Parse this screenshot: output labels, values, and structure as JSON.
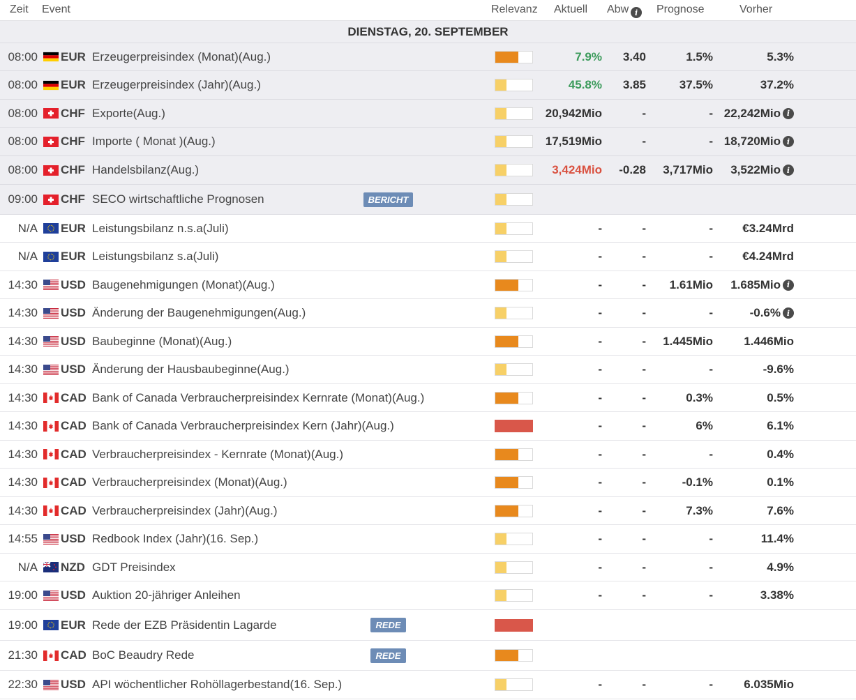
{
  "header": {
    "zeit": "Zeit",
    "event": "Event",
    "relevanz": "Relevanz",
    "aktuell": "Aktuell",
    "abw": "Abw",
    "prognose": "Prognose",
    "vorher": "Vorher"
  },
  "day_label": "DIENSTAG, 20. SEPTEMBER",
  "colors": {
    "high": "#e8891d",
    "high_light": "#f7d067",
    "max": "#d9574a",
    "positive": "#3a9a5a",
    "negative": "#d9503f",
    "badge": "#6d8cb6"
  },
  "rows": [
    {
      "time": "08:00",
      "flag": "DE",
      "currency": "EUR",
      "event": "Erzeugerpreisindex (Monat)(Aug.)",
      "relevance": "medium",
      "actual": "7.9%",
      "actual_state": "pos",
      "abw": "3.40",
      "forecast": "1.5%",
      "previous": "5.3%",
      "info": false,
      "hl": true,
      "h": 40
    },
    {
      "time": "08:00",
      "flag": "DE",
      "currency": "EUR",
      "event": "Erzeugerpreisindex (Jahr)(Aug.)",
      "relevance": "low",
      "actual": "45.8%",
      "actual_state": "pos",
      "abw": "3.85",
      "forecast": "37.5%",
      "previous": "37.2%",
      "info": false,
      "hl": true,
      "h": 41
    },
    {
      "time": "08:00",
      "flag": "CH",
      "currency": "CHF",
      "event": "Exporte(Aug.)",
      "relevance": "low",
      "actual": "20,942Mio",
      "actual_state": "neutral",
      "abw": "-",
      "forecast": "-",
      "previous": "22,242Mio",
      "info": true,
      "hl": true,
      "h": 40
    },
    {
      "time": "08:00",
      "flag": "CH",
      "currency": "CHF",
      "event": "Importe ( Monat )(Aug.)",
      "relevance": "low",
      "actual": "17,519Mio",
      "actual_state": "neutral",
      "abw": "-",
      "forecast": "-",
      "previous": "18,720Mio",
      "info": true,
      "hl": true,
      "h": 41
    },
    {
      "time": "08:00",
      "flag": "CH",
      "currency": "CHF",
      "event": "Handelsbilanz(Aug.)",
      "relevance": "low",
      "actual": "3,424Mio",
      "actual_state": "neg",
      "abw": "-0.28",
      "forecast": "3,717Mio",
      "previous": "3,522Mio",
      "info": true,
      "hl": true,
      "h": 41
    },
    {
      "time": "09:00",
      "flag": "CH",
      "currency": "CHF",
      "event": "SECO wirtschaftliche Prognosen",
      "relevance": "low",
      "badge": "BERICHT",
      "hl": true,
      "h": 43
    },
    {
      "time": "N/A",
      "flag": "EU",
      "currency": "EUR",
      "event": "Leistungsbilanz n.s.a(Juli)",
      "relevance": "low",
      "actual": "-",
      "abw": "-",
      "forecast": "-",
      "previous": "€3.24Mrd",
      "info": false,
      "h": 40
    },
    {
      "time": "N/A",
      "flag": "EU",
      "currency": "EUR",
      "event": "Leistungsbilanz s.a(Juli)",
      "relevance": "low",
      "actual": "-",
      "abw": "-",
      "forecast": "-",
      "previous": "€4.24Mrd",
      "info": false,
      "h": 41
    },
    {
      "time": "14:30",
      "flag": "US",
      "currency": "USD",
      "event": "Baugenehmigungen (Monat)(Aug.)",
      "relevance": "medium",
      "actual": "-",
      "abw": "-",
      "forecast": "1.61Mio",
      "previous": "1.685Mio",
      "info": true,
      "h": 40
    },
    {
      "time": "14:30",
      "flag": "US",
      "currency": "USD",
      "event": "Änderung der Baugenehmigungen(Aug.)",
      "relevance": "low",
      "actual": "-",
      "abw": "-",
      "forecast": "-",
      "previous": "-0.6%",
      "info": true,
      "h": 41
    },
    {
      "time": "14:30",
      "flag": "US",
      "currency": "USD",
      "event": "Baubeginne (Monat)(Aug.)",
      "relevance": "medium",
      "actual": "-",
      "abw": "-",
      "forecast": "1.445Mio",
      "previous": "1.446Mio",
      "info": false,
      "h": 40
    },
    {
      "time": "14:30",
      "flag": "US",
      "currency": "USD",
      "event": "Änderung der Hausbaubeginne(Aug.)",
      "relevance": "low",
      "actual": "-",
      "abw": "-",
      "forecast": "-",
      "previous": "-9.6%",
      "info": false,
      "h": 41
    },
    {
      "time": "14:30",
      "flag": "CA",
      "currency": "CAD",
      "event": "Bank of Canada Verbraucherpreisindex Kernrate (Monat)(Aug.)",
      "relevance": "medium",
      "actual": "-",
      "abw": "-",
      "forecast": "0.3%",
      "previous": "0.5%",
      "info": false,
      "h": 40
    },
    {
      "time": "14:30",
      "flag": "CA",
      "currency": "CAD",
      "event": "Bank of Canada Verbraucherpreisindex Kern (Jahr)(Aug.)",
      "relevance": "high",
      "actual": "-",
      "abw": "-",
      "forecast": "6%",
      "previous": "6.1%",
      "info": false,
      "h": 41
    },
    {
      "time": "14:30",
      "flag": "CA",
      "currency": "CAD",
      "event": "Verbraucherpreisindex - Kernrate (Monat)(Aug.)",
      "relevance": "medium",
      "actual": "-",
      "abw": "-",
      "forecast": "-",
      "previous": "0.4%",
      "info": false,
      "h": 40
    },
    {
      "time": "14:30",
      "flag": "CA",
      "currency": "CAD",
      "event": "Verbraucherpreisindex (Monat)(Aug.)",
      "relevance": "medium",
      "actual": "-",
      "abw": "-",
      "forecast": "-0.1%",
      "previous": "0.1%",
      "info": false,
      "h": 41
    },
    {
      "time": "14:30",
      "flag": "CA",
      "currency": "CAD",
      "event": "Verbraucherpreisindex (Jahr)(Aug.)",
      "relevance": "medium",
      "actual": "-",
      "abw": "-",
      "forecast": "7.3%",
      "previous": "7.6%",
      "info": false,
      "h": 40
    },
    {
      "time": "14:55",
      "flag": "US",
      "currency": "USD",
      "event": "Redbook Index (Jahr)(16. Sep.)",
      "relevance": "low",
      "actual": "-",
      "abw": "-",
      "forecast": "-",
      "previous": "11.4%",
      "info": false,
      "h": 41
    },
    {
      "time": "N/A",
      "flag": "NZ",
      "currency": "NZD",
      "event": "GDT Preisindex",
      "relevance": "low",
      "actual": "-",
      "abw": "-",
      "forecast": "-",
      "previous": "4.9%",
      "info": false,
      "h": 40
    },
    {
      "time": "19:00",
      "flag": "US",
      "currency": "USD",
      "event": "Auktion 20-jähriger Anleihen",
      "relevance": "low",
      "actual": "-",
      "abw": "-",
      "forecast": "-",
      "previous": "3.38%",
      "info": false,
      "h": 41
    },
    {
      "time": "19:00",
      "flag": "EU",
      "currency": "EUR",
      "event": "Rede der EZB Präsidentin Lagarde",
      "relevance": "high",
      "badge": "REDE",
      "h": 44
    },
    {
      "time": "21:30",
      "flag": "CA",
      "currency": "CAD",
      "event": "BoC Beaudry Rede",
      "relevance": "medium",
      "badge": "REDE",
      "h": 43
    },
    {
      "time": "22:30",
      "flag": "US",
      "currency": "USD",
      "event": "API wöchentlicher Rohöllagerbestand(16. Sep.)",
      "relevance": "low",
      "actual": "-",
      "abw": "-",
      "forecast": "-",
      "previous": "6.035Mio",
      "info": false,
      "h": 41
    }
  ]
}
